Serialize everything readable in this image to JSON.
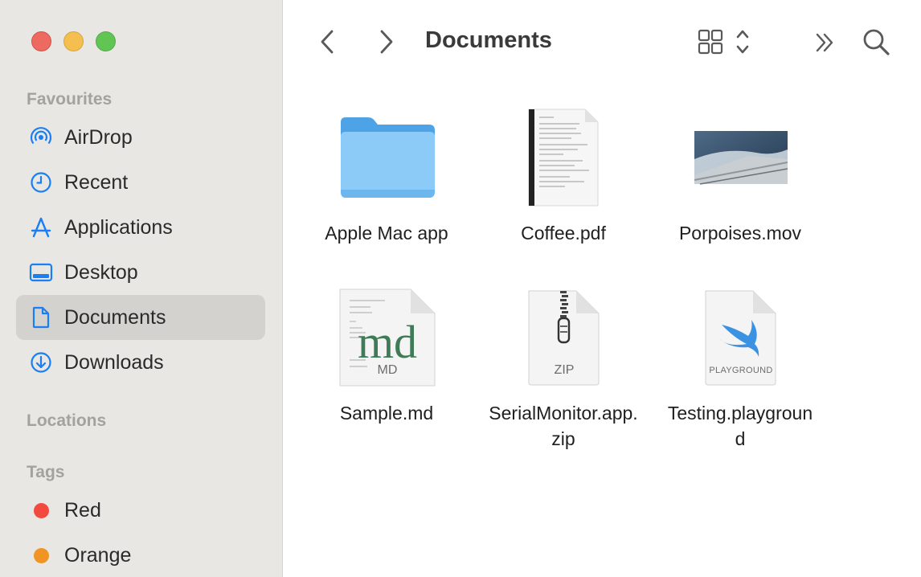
{
  "window": {
    "title": "Documents"
  },
  "sidebar": {
    "sections": {
      "favourites": "Favourites",
      "locations": "Locations",
      "tags": "Tags"
    },
    "favourites": [
      {
        "label": "AirDrop",
        "icon": "airdrop-icon"
      },
      {
        "label": "Recent",
        "icon": "clock-icon"
      },
      {
        "label": "Applications",
        "icon": "applications-icon"
      },
      {
        "label": "Desktop",
        "icon": "desktop-icon"
      },
      {
        "label": "Documents",
        "icon": "document-icon",
        "selected": true
      },
      {
        "label": "Downloads",
        "icon": "download-icon"
      }
    ],
    "tags": [
      {
        "label": "Red",
        "color": "#f34a3f"
      },
      {
        "label": "Orange",
        "color": "#f09524"
      }
    ]
  },
  "toolbar": {
    "back_icon": "chevron-left-icon",
    "forward_icon": "chevron-right-icon",
    "view_icon": "icon-grid-view-icon",
    "more_icon": "double-chevron-right-icon",
    "search_icon": "search-icon"
  },
  "files": [
    {
      "name": "Apple Mac app",
      "kind": "folder"
    },
    {
      "name": "Coffee.pdf",
      "kind": "pdf"
    },
    {
      "name": "Porpoises.mov",
      "kind": "movie"
    },
    {
      "name": "Sample.md",
      "kind": "markdown",
      "badge": "MD",
      "logo": "md"
    },
    {
      "name_line1": "SerialMonitor.app.",
      "name_line2": "zip",
      "kind": "zip",
      "badge": "ZIP"
    },
    {
      "name_line1": "Testing.playgroun",
      "name_line2": "d",
      "kind": "playground",
      "badge": "PLAYGROUND"
    }
  ],
  "colors": {
    "accent": "#1a7ef5",
    "sidebar_bg": "#e8e7e3",
    "selected_bg": "#d3d2ce",
    "folder": "#6cb6f0"
  }
}
